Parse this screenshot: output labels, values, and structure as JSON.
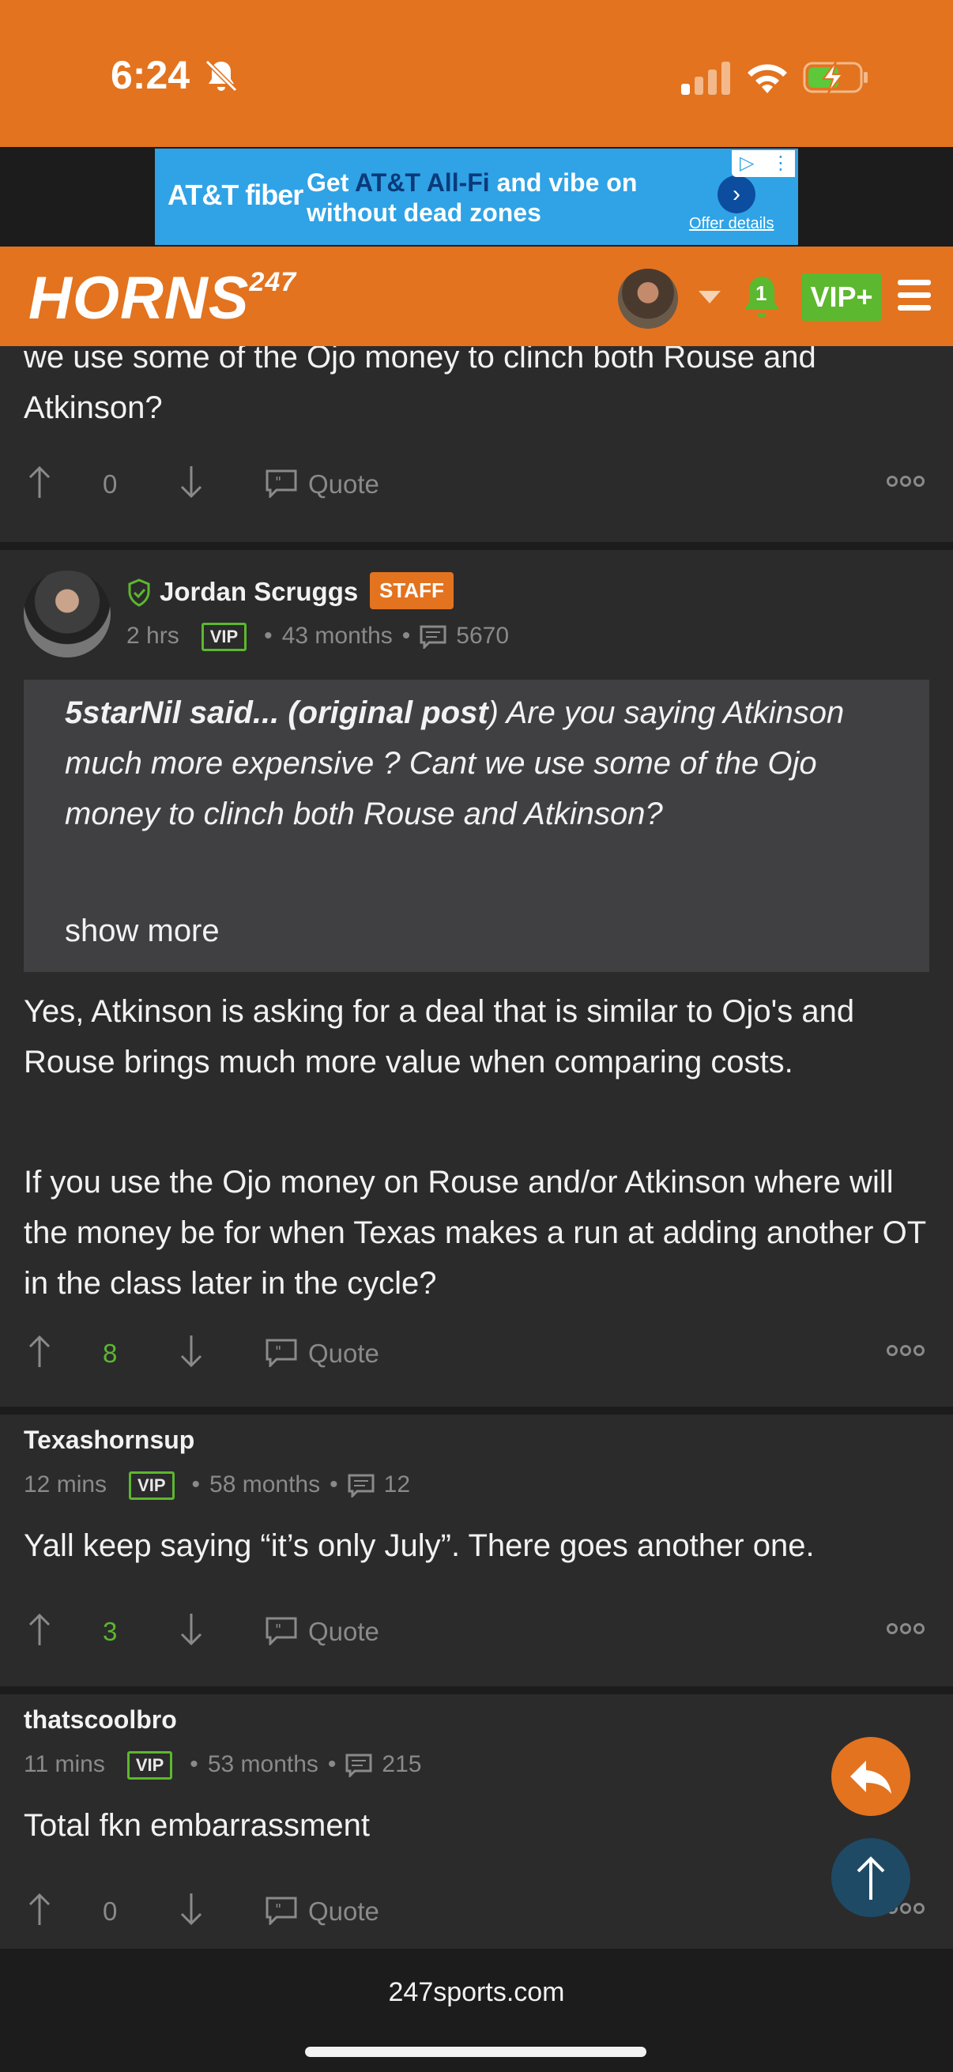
{
  "status_bar": {
    "time": "6:24"
  },
  "ad": {
    "brand": "AT&T fiber",
    "headline_line1_pre": "Get ",
    "headline_line1_hl": "AT&T All-Fi",
    "headline_line1_post": " and vibe on",
    "headline_line2": "without dead zones",
    "offer": "Offer details"
  },
  "header": {
    "logo": "HORNS",
    "logo_sup": "247",
    "notification_count": "1",
    "vip_label": "VIP+"
  },
  "posts": [
    {
      "body_partial": "we use some of the Ojo money to clinch both Rouse and Atkinson?",
      "upvotes": "0",
      "quote_label": "Quote"
    },
    {
      "author": "Jordan Scruggs",
      "badge": "STAFF",
      "time": "2 hrs",
      "vip": "VIP",
      "tenure": "43 months",
      "post_count": "5670",
      "quote_author": "5starNil said... (original post",
      "quote_text": ") Are you saying Atkinson much more expensive ? Cant we use some of the Ojo money to clinch both Rouse and Atkinson?",
      "show_more": "show more",
      "paragraph1": "Yes, Atkinson is asking for a deal that is similar to Ojo's and Rouse brings much more value when comparing costs.",
      "paragraph2": "If you use the Ojo money on Rouse and/or Atkinson where will the money be for when Texas makes a run at adding another OT in the class later in the cycle?",
      "upvotes": "8",
      "quote_label": "Quote"
    },
    {
      "author": "Texashornsup",
      "time": "12 mins",
      "vip": "VIP",
      "tenure": "58 months",
      "post_count": "12",
      "body": "Yall keep saying “it’s only July”. There goes another one.",
      "upvotes": "3",
      "quote_label": "Quote"
    },
    {
      "author": "thatscoolbro",
      "time": "11 mins",
      "vip": "VIP",
      "tenure": "53 months",
      "post_count": "215",
      "body": "Total fkn embarrassment",
      "upvotes": "0",
      "quote_label": "Quote"
    }
  ],
  "browser": {
    "url": "247sports.com"
  },
  "colors": {
    "accent": "#e3731f",
    "vip_green": "#5cb82e",
    "background": "#2b2b2b",
    "muted": "#8a8a8a"
  }
}
